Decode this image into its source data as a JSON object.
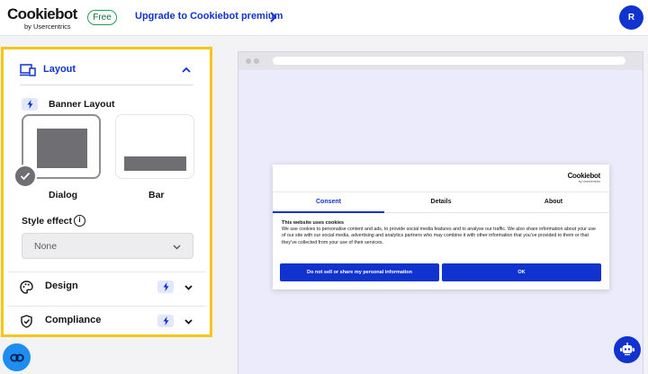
{
  "header": {
    "logo_main": "Cookiebot",
    "logo_sub": "by Usercentrics",
    "plan_badge": "Free",
    "upgrade_link": "Upgrade to Cookiebot premium",
    "avatar_initial": "R"
  },
  "sidebar": {
    "layout": {
      "title": "Layout",
      "banner_layout_title": "Banner Layout",
      "options": [
        {
          "label": "Dialog",
          "selected": true
        },
        {
          "label": "Bar",
          "selected": false
        }
      ],
      "style_effect_label": "Style effect",
      "style_effect_value": "None"
    },
    "sections": [
      {
        "label": "Design"
      },
      {
        "label": "Compliance"
      }
    ]
  },
  "preview": {
    "dialog": {
      "logo_main": "Cookiebot",
      "logo_sub": "by Usercentrics",
      "tabs": [
        "Consent",
        "Details",
        "About"
      ],
      "active_tab": "Consent",
      "title": "This website uses cookies",
      "body": "We use cookies to personalise content and ads, to provide social media features and to analyse our traffic. We also share information about your use of our site with our social media, advertising and analytics partners who may combine it with other information that you’ve provided to them or that they’ve collected from your use of their services.",
      "decline_button": "Do not sell or share my personal information",
      "accept_button": "OK"
    }
  },
  "colors": {
    "brand_blue": "#1032cf",
    "highlight_yellow": "#f5c518",
    "free_green": "#1f9e55",
    "fab_blue": "#1d8ef0",
    "preview_bg": "#ebebfb"
  }
}
